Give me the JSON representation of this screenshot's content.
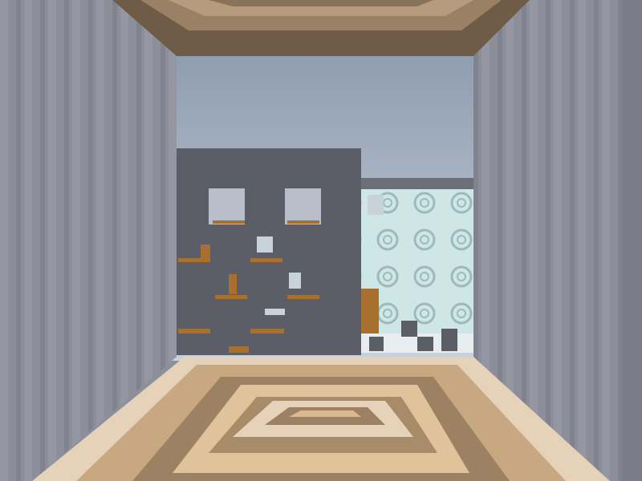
{
  "scene": {
    "type": "first-person block-world corridor view",
    "colors": {
      "sky_top": "#8e9cb0",
      "sky_bottom": "#c9d2da",
      "wall_left": "#8c8f99",
      "wall_right": "#8a8d97",
      "ceiling_dark": "#6e5c48",
      "ceiling_light": "#b69c7c",
      "floor_dark": "#9c8263",
      "floor_mid": "#c7a880",
      "floor_light": "#e6d2b8",
      "building_dark": "#5b5e67",
      "building_light": "#cfe6e6",
      "wood": "#a8702e"
    }
  }
}
